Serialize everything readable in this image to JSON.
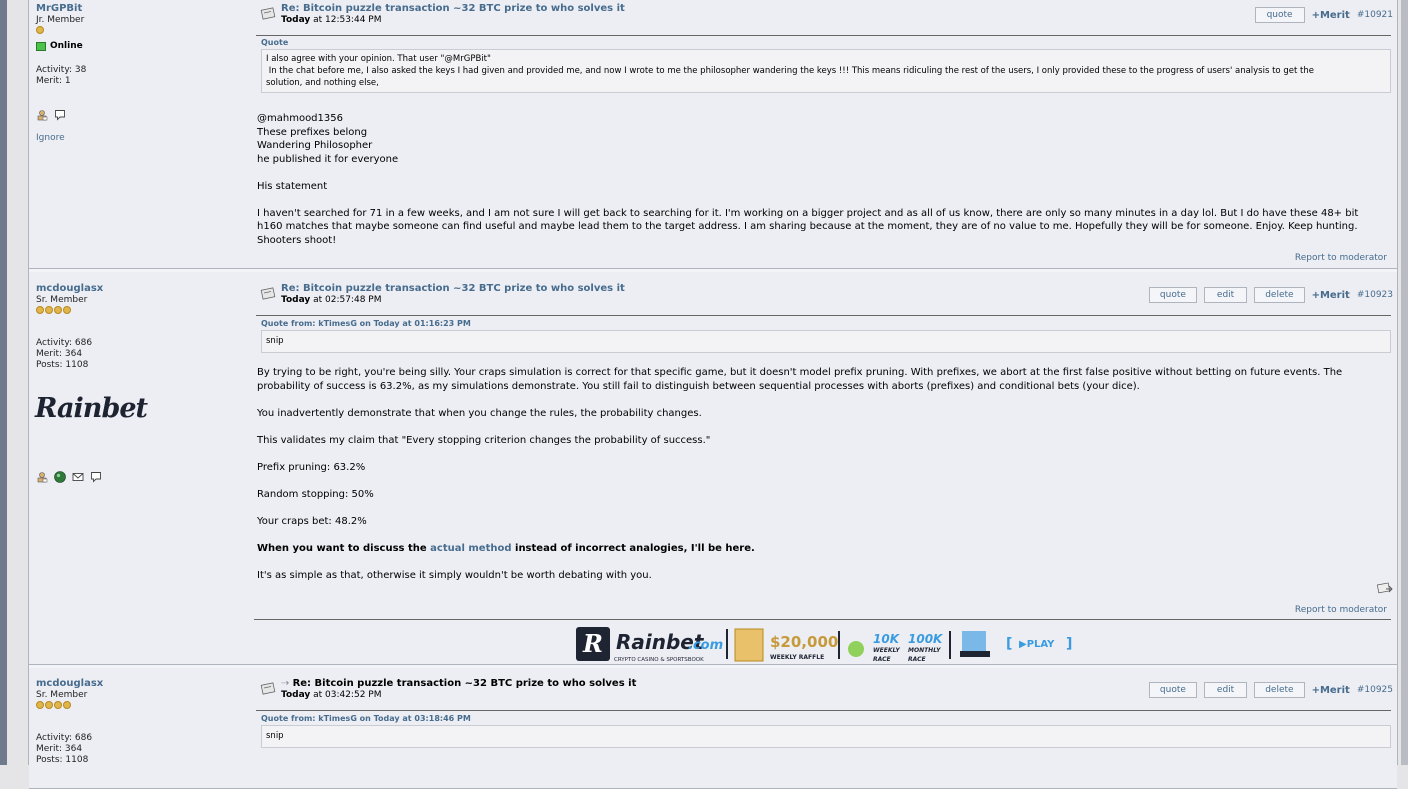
{
  "posts": [
    {
      "author": "MrGPBit",
      "rank": "Jr. Member",
      "stars": 1,
      "online": "Online",
      "activity": "Activity: 38",
      "merit": "Merit: 1",
      "ignore": "Ignore",
      "subject": "Re: Bitcoin puzzle transaction ~32 BTC prize to who solves it",
      "date_bold": "Today",
      "time": " at 12:53:44 PM",
      "buttons": [
        "quote"
      ],
      "merit_link": "+Merit",
      "number": "#10921",
      "quote_header": "Quote",
      "quote_lines": [
        "I also agree with your opinion. That user \"@MrGPBit\"",
        " In the chat before me, I also asked the keys I had given and provided me, and now I wrote to me the philosopher wandering the keys !!! This means ridiculing the rest of the users, I only provided these to the progress of users' analysis to get the",
        "solution, and nothing else,"
      ],
      "body": {
        "l1": "@mahmood1356",
        "l2": "These prefixes belong",
        "l3": "Wandering Philosopher",
        "l4": "he published it for everyone",
        "l5": "His statement",
        "l6": "I haven't searched for 71 in a few weeks, and I am not sure I will get back to searching for it. I'm working on a bigger project and as all of us know, there are only so many minutes in a day lol. But I do have these 48+ bit h160 matches that maybe someone can find useful and maybe lead them to the target address. I am sharing because at the moment, they are of no value to me. Hopefully they will be for someone. Enjoy. Keep hunting. Shooters shoot!"
      },
      "report": "Report to moderator"
    },
    {
      "author": "mcdouglasx",
      "rank": "Sr. Member",
      "stars": 4,
      "activity": "Activity: 686",
      "merit": "Merit: 364",
      "posts": "Posts: 1108",
      "avatar_text": "Rainbet",
      "subject": "Re: Bitcoin puzzle transaction ~32 BTC prize to who solves it",
      "date_bold": "Today",
      "time": " at 02:57:48 PM",
      "buttons": [
        "quote",
        "edit",
        "delete"
      ],
      "merit_link": "+Merit",
      "number": "#10923",
      "quote_header": "Quote from: kTimesG on Today at 01:16:23 PM",
      "quote_text": "snip",
      "body": {
        "p1": "By trying to be right, you're being silly. Your craps simulation is correct for that specific game, but it doesn't model prefix pruning. With prefixes, we abort at the first false positive without betting on future events. The probability of success is 63.2%, as my simulations demonstrate. You still fail to distinguish between sequential processes with aborts (prefixes) and conditional bets (your dice).",
        "p2": "You inadvertently demonstrate that when you change the rules, the probability changes.",
        "p3": "This validates my claim that \"Every stopping criterion changes the probability of success.\"",
        "p4": "Prefix pruning: 63.2%",
        "p5": "Random stopping: 50%",
        "p6": "Your craps bet: 48.2%",
        "p7a": "When you want to discuss the ",
        "p7link": "actual method",
        "p7b": " instead of incorrect analogies, I'll be here.",
        "p8": "It's as simple as that, otherwise it simply wouldn't be worth debating with you."
      },
      "report": "Report to moderator",
      "signature": {
        "brand": "Rainbet",
        "brand_suffix": ".com",
        "tagline": "CRYPTO CASINO & SPORTSBOOK",
        "prize": "$20,000",
        "prize_sub": "WEEKLY RAFFLE",
        "weekly": "10K",
        "weekly_sub1": "WEEKLY",
        "weekly_sub2": "RACE",
        "monthly": "100K",
        "monthly_sub1": "MONTHLY",
        "monthly_sub2": "RACE",
        "play": "▶PLAY"
      }
    },
    {
      "author": "mcdouglasx",
      "rank": "Sr. Member",
      "stars": 4,
      "activity": "Activity: 686",
      "merit": "Merit: 364",
      "posts": "Posts: 1108",
      "subject": "Re: Bitcoin puzzle transaction ~32 BTC prize to who solves it",
      "date_bold": "Today",
      "time": " at 03:42:52 PM",
      "buttons": [
        "quote",
        "edit",
        "delete"
      ],
      "merit_link": "+Merit",
      "number": "#10925",
      "quote_header": "Quote from: kTimesG on Today at 03:18:46 PM",
      "quote_text": "snip"
    }
  ]
}
